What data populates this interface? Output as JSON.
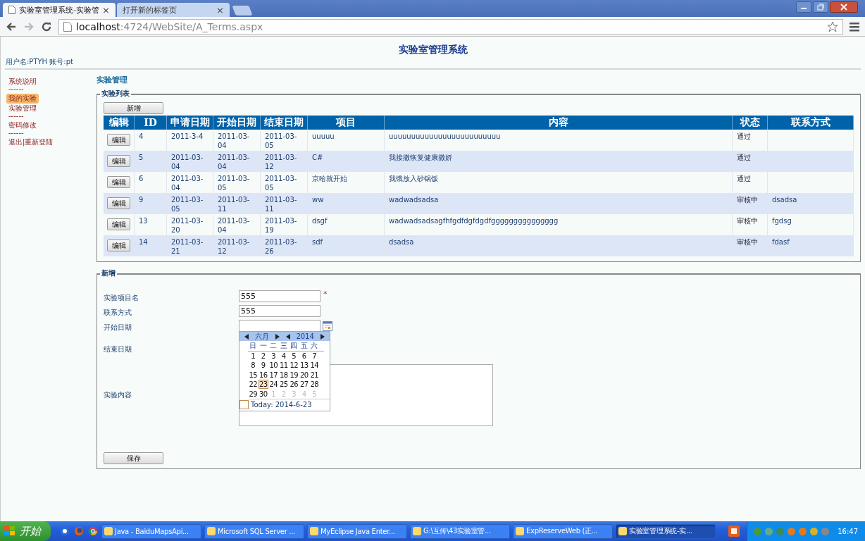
{
  "browser": {
    "tabs": [
      {
        "title": "实验室管理系统-实验管",
        "selected": true,
        "close": "×"
      },
      {
        "title": "打开新的标签页",
        "selected": false,
        "close": "×"
      }
    ],
    "url_host": "localhost",
    "url_path": ":4724/WebSite/A_Terms.aspx"
  },
  "page": {
    "title": "实验室管理系统",
    "user_info": "用户名:PTYH 账号:pt"
  },
  "sidebar": {
    "items": [
      {
        "kind": "link",
        "label": "系统说明",
        "selected": false
      },
      {
        "kind": "separator",
        "label": "------"
      },
      {
        "kind": "link",
        "label": "我的实验",
        "selected": true
      },
      {
        "kind": "link",
        "label": "实验管理",
        "selected": false
      },
      {
        "kind": "separator",
        "label": "------"
      },
      {
        "kind": "link",
        "label": "密码修改",
        "selected": false
      },
      {
        "kind": "separator",
        "label": "------"
      },
      {
        "kind": "link",
        "label": "退出|重新登陆",
        "selected": false
      }
    ]
  },
  "breadcrumb": "实验管理",
  "list_section": {
    "legend": "实验列表",
    "add_button": "新增",
    "columns": [
      "编辑",
      "ID",
      "申请日期",
      "开始日期",
      "结束日期",
      "项目",
      "内容",
      "状态",
      "联系方式"
    ],
    "rows": [
      {
        "edit": "编辑",
        "id": "4",
        "applied": "2011-3-4",
        "start": "2011-03-04",
        "end": "2011-03-05",
        "project": "uuuuu",
        "content": "uuuuuuuuuuuuuuuuuuuuuuuuu",
        "status": "通过"
      },
      {
        "edit": "编辑",
        "id": "5",
        "applied": "2011-03-04",
        "start": "2011-03-04",
        "end": "2011-03-12",
        "project": "C#",
        "content": "我接撒恢复健康撒娇",
        "status": "通过"
      },
      {
        "edit": "编辑",
        "id": "6",
        "applied": "2011-03-04",
        "start": "2011-03-05",
        "end": "2011-03-05",
        "project": "京哈就开始",
        "content": "我饿放入砂锅饭",
        "status": "通过"
      },
      {
        "edit": "编辑",
        "id": "9",
        "applied": "2011-03-05",
        "start": "2011-03-11",
        "end": "2011-03-11",
        "project": "ww",
        "content": "wadwadsadsa",
        "status": "审核中",
        "contact": "dsadsa"
      },
      {
        "edit": "编辑",
        "id": "13",
        "applied": "2011-03-20",
        "start": "2011-03-04",
        "end": "2011-03-19",
        "project": "dsgf",
        "content": "wadwadsadsagfhfgdfdgfdgdfggggggggggggggg",
        "status": "审核中",
        "contact": "fgdsg"
      },
      {
        "edit": "编辑",
        "id": "14",
        "applied": "2011-03-21",
        "start": "2011-03-12",
        "end": "2011-03-26",
        "project": "sdf",
        "content": "dsadsa",
        "status": "审核中",
        "contact": "fdasf"
      }
    ]
  },
  "form_section": {
    "legend": "新增",
    "fields": [
      {
        "kind": "text",
        "label": "实验项目名",
        "value": "555",
        "required": true,
        "required_mark": "*"
      },
      {
        "kind": "text",
        "label": "联系方式",
        "value": "555",
        "required": false
      },
      {
        "kind": "date",
        "label": "开始日期"
      },
      {
        "kind": "covered",
        "label": "结束日期"
      },
      {
        "kind": "textarea",
        "label": "实验内容"
      }
    ],
    "save_button": "保存"
  },
  "calendar": {
    "month": "六月",
    "year": "2014",
    "weekdays": [
      "日",
      "一",
      "二",
      "三",
      "四",
      "五",
      "六"
    ],
    "weeks": [
      [
        {
          "day": "1",
          "other": false,
          "selected": false
        },
        {
          "day": "2",
          "other": false,
          "selected": false
        },
        {
          "day": "3",
          "other": false,
          "selected": false
        },
        {
          "day": "4",
          "other": false,
          "selected": false
        },
        {
          "day": "5",
          "other": false,
          "selected": false
        },
        {
          "day": "6",
          "other": false,
          "selected": false
        },
        {
          "day": "7",
          "other": false,
          "selected": false
        }
      ],
      [
        {
          "day": "8",
          "other": false,
          "selected": false
        },
        {
          "day": "9",
          "other": false,
          "selected": false
        },
        {
          "day": "10",
          "other": false,
          "selected": false
        },
        {
          "day": "11",
          "other": false,
          "selected": false
        },
        {
          "day": "12",
          "other": false,
          "selected": false
        },
        {
          "day": "13",
          "other": false,
          "selected": false
        },
        {
          "day": "14",
          "other": false,
          "selected": false
        }
      ],
      [
        {
          "day": "15",
          "other": false,
          "selected": false
        },
        {
          "day": "16",
          "other": false,
          "selected": false
        },
        {
          "day": "17",
          "other": false,
          "selected": false
        },
        {
          "day": "18",
          "other": false,
          "selected": false
        },
        {
          "day": "19",
          "other": false,
          "selected": false
        },
        {
          "day": "20",
          "other": false,
          "selected": false
        },
        {
          "day": "21",
          "other": false,
          "selected": false
        }
      ],
      [
        {
          "day": "22",
          "other": false,
          "selected": false
        },
        {
          "day": "23",
          "other": false,
          "selected": true
        },
        {
          "day": "24",
          "other": false,
          "selected": false
        },
        {
          "day": "25",
          "other": false,
          "selected": false
        },
        {
          "day": "26",
          "other": false,
          "selected": false
        },
        {
          "day": "27",
          "other": false,
          "selected": false
        },
        {
          "day": "28",
          "other": false,
          "selected": false
        }
      ],
      [
        {
          "day": "29",
          "other": false,
          "selected": false
        },
        {
          "day": "30",
          "other": false,
          "selected": false
        },
        {
          "day": "1",
          "other": true,
          "selected": false
        },
        {
          "day": "2",
          "other": true,
          "selected": false
        },
        {
          "day": "3",
          "other": true,
          "selected": false
        },
        {
          "day": "4",
          "other": true,
          "selected": false
        },
        {
          "day": "5",
          "other": true,
          "selected": false
        }
      ]
    ],
    "today": "Today: 2014-6-23"
  },
  "taskbar": {
    "start": "开始",
    "tasks": [
      {
        "label": "Java - BaiduMapsApi...",
        "selected": false
      },
      {
        "label": "Microsoft SQL Server ...",
        "selected": false
      },
      {
        "label": "MyEclipse Java Enter...",
        "selected": false
      },
      {
        "label": "G:\\互传\\43实验室管...",
        "selected": false
      },
      {
        "label": "ExpReserveWeb (正...",
        "selected": false
      },
      {
        "label": "实验室管理系统-实...",
        "selected": true
      }
    ],
    "clock": "16:47"
  }
}
